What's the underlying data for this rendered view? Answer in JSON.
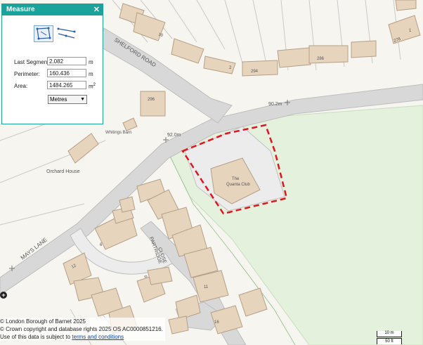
{
  "panel": {
    "title": "Measure",
    "close_icon": "close-icon",
    "tool_area_icon": "measure-area-icon",
    "tool_line_icon": "measure-line-icon",
    "last_segment_label": "Last Segment:",
    "last_segment_value": "2.082",
    "last_segment_unit": "m",
    "perimeter_label": "Perimeter:",
    "perimeter_value": "160.436",
    "perimeter_unit": "m",
    "area_label": "Area:",
    "area_value": "1484.265",
    "area_unit": "m",
    "area_unit_sup": "2",
    "units_selected": "Metres"
  },
  "map": {
    "labels": {
      "shelford_road": "SHELFORD ROAD",
      "mays_lane": "MAYS LANE",
      "partridge": "PARTRIDGE",
      "close": "CLOSE",
      "orchard_house": "Orchard House",
      "whitings_barn": "Whitings Barn",
      "the": "The",
      "quanta_club": "Quanta Club",
      "spot_90": "90.2m",
      "spot_92": "92.0m",
      "hn_10": "10",
      "hn_2": "2",
      "hn_294": "294",
      "hn_286": "286",
      "hn_278": "278",
      "hn_296": "296",
      "hn_1": "1",
      "hn_6": "6",
      "hn_12": "12",
      "hn_9": "9",
      "hn_11": "11",
      "hn_16": "16"
    },
    "colors": {
      "grass": "#e3f1dd",
      "road": "#d6d6d6",
      "building": "#e7d4bd",
      "measure_outline": "#e8121f"
    },
    "zoom_in_icon": "plus-icon"
  },
  "attribution": {
    "line1": "© London Borough of Barnet 2025",
    "line2": "© Crown copyright and database rights 2025 OS AC0000851216.",
    "line3_prefix": "Use of this data is subject to ",
    "line3_link": "terms and conditions"
  },
  "scale": {
    "metric": "10 m",
    "imperial": "50 ft"
  }
}
